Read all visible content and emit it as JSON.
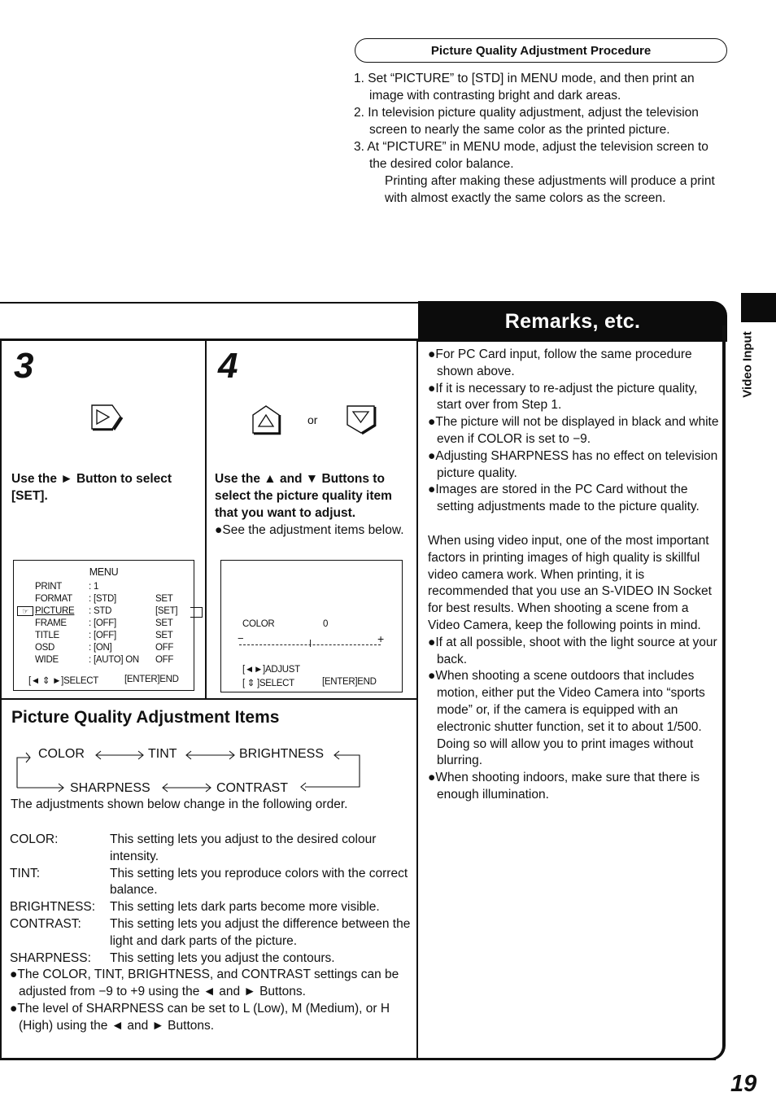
{
  "procedure": {
    "title": "Picture Quality Adjustment Procedure",
    "steps": [
      {
        "num": "1.",
        "text": "Set “PICTURE” to [STD] in MENU mode, and then print an image with contrasting bright and dark areas."
      },
      {
        "num": "2.",
        "text": "In television picture quality adjustment, adjust the television screen to nearly the same color as the printed picture."
      },
      {
        "num": "3.",
        "text": "At “PICTURE” in MENU mode, adjust the television screen to the desired color balance."
      }
    ],
    "note": "Printing after making these adjustments will produce a print with almost exactly the same colors as the screen."
  },
  "step3": {
    "number": "3",
    "button_icon": "right-arrow-button",
    "text": "Use the ► Button to select [SET].",
    "menu_screen": {
      "title": "MENU",
      "rows": [
        {
          "label": "PRINT",
          "value": "1",
          "set": ""
        },
        {
          "label": "FORMAT",
          "value": "[STD]",
          "set": "SET"
        },
        {
          "label": "PICTURE",
          "value": "STD",
          "set": "[SET]",
          "selected": true
        },
        {
          "label": "FRAME",
          "value": "[OFF]",
          "set": "SET"
        },
        {
          "label": "TITLE",
          "value": "[OFF]",
          "set": "SET"
        },
        {
          "label": "OSD",
          "value": "[ON]",
          "set": "OFF"
        },
        {
          "label": "WIDE",
          "value": "[AUTO]  ON",
          "set": "OFF"
        }
      ],
      "footer_left": "[◄ ⇕ ►]SELECT",
      "footer_right": "[ENTER]END"
    }
  },
  "step4": {
    "number": "4",
    "or_label": "or",
    "text": "Use the ▲ and ▼ Buttons to select the picture quality item that you want to adjust.",
    "bullet": "●See the adjustment items below.",
    "adjust_screen": {
      "item_label": "COLOR",
      "item_value": "0",
      "level": 0,
      "range": [
        -9,
        9
      ],
      "minus": "−",
      "plus": "+",
      "footer_adjust": "[◄►]ADJUST",
      "footer_select": "[ ⇕ ]SELECT",
      "footer_end": "[ENTER]END"
    }
  },
  "items": {
    "title": "Picture Quality Adjustment Items",
    "cycle": [
      "COLOR",
      "TINT",
      "BRIGHTNESS",
      "SHARPNESS",
      "CONTRAST"
    ],
    "intro": "The adjustments shown below change in the following order.",
    "definitions": [
      {
        "term": "COLOR:",
        "desc": "This setting lets you adjust to the desired colour intensity."
      },
      {
        "term": "TINT:",
        "desc": "This setting lets you reproduce colors with the correct balance."
      },
      {
        "term": "BRIGHTNESS:",
        "desc": "This setting lets dark parts become more visible."
      },
      {
        "term": "CONTRAST:",
        "desc": "This setting lets you adjust the difference between the light and dark parts of the picture."
      },
      {
        "term": "SHARPNESS:",
        "desc": "This setting lets you adjust the contours."
      }
    ],
    "bullets": [
      "●The COLOR, TINT, BRIGHTNESS, and CONTRAST settings can be adjusted from −9 to +9 using the ◄ and ► Buttons.",
      "●The level of SHARPNESS can be set to L (Low), M (Medium), or H (High) using the ◄ and ► Buttons."
    ]
  },
  "remarks": {
    "title": "Remarks, etc.",
    "bullets": [
      "●For PC Card input, follow the same procedure shown above.",
      "●If it is necessary to re-adjust the picture quality, start over from Step 1.",
      "●The picture will not be displayed in black and white even if COLOR is set to −9.",
      "●Adjusting SHARPNESS has no effect on television picture quality.",
      "●Images are stored in the PC Card without the setting adjustments made to the picture quality."
    ],
    "paragraph": "When using video input, one of the most important factors in printing images of high quality is skillful video camera work. When printing, it is recommended that you use an S-VIDEO IN Socket for best results. When shooting a scene from a Video Camera, keep the following points in mind.",
    "tips": [
      "●If at all possible, shoot with the light source at your back.",
      "●When shooting a scene outdoors that includes motion, either put the Video Camera into “sports mode” or, if the camera is equipped with an electronic shutter function, set it to about 1/500. Doing so will allow you to print images without blurring.",
      "●When shooting indoors, make sure that there is enough illumination."
    ]
  },
  "side_tab": {
    "label": "Video Input"
  },
  "page_number": "19"
}
